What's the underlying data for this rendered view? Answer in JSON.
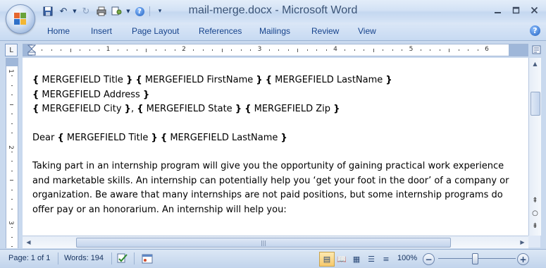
{
  "window": {
    "title": "mail-merge.docx - Microsoft Word",
    "controls": [
      "minimize-icon",
      "maximize-icon",
      "close-icon"
    ]
  },
  "quick_access": [
    "save-icon",
    "undo-icon",
    "redo-icon",
    "print-preview-icon",
    "customize-icon",
    "help-icon"
  ],
  "ribbon": {
    "tabs": [
      "Home",
      "Insert",
      "Page Layout",
      "References",
      "Mailings",
      "Review",
      "View"
    ]
  },
  "ruler": {
    "marks": [
      "1",
      "2",
      "3",
      "4",
      "5",
      "6"
    ],
    "vertical_marks": [
      "1",
      "2",
      "3"
    ]
  },
  "document": {
    "lines": [
      {
        "parts": [
          [
            "{",
            "b"
          ],
          [
            " MERGEFIELD Title ",
            "n"
          ],
          [
            "}",
            "b"
          ],
          [
            " ",
            "n"
          ],
          [
            "{",
            "b"
          ],
          [
            " MERGEFIELD FirstName ",
            "n"
          ],
          [
            "}",
            "b"
          ],
          [
            " ",
            "n"
          ],
          [
            "{",
            "b"
          ],
          [
            " MERGEFIELD LastName ",
            "n"
          ],
          [
            "}",
            "b"
          ]
        ]
      },
      {
        "parts": [
          [
            "{",
            "b"
          ],
          [
            " MERGEFIELD Address  ",
            "n"
          ],
          [
            "}",
            "b"
          ]
        ]
      },
      {
        "parts": [
          [
            "{",
            "b"
          ],
          [
            " MERGEFIELD City ",
            "n"
          ],
          [
            "}",
            "b"
          ],
          [
            ", ",
            "n"
          ],
          [
            "{",
            "b"
          ],
          [
            " MERGEFIELD State  ",
            "n"
          ],
          [
            "}",
            "b"
          ],
          [
            " ",
            "n"
          ],
          [
            "{",
            "b"
          ],
          [
            " MERGEFIELD Zip ",
            "n"
          ],
          [
            "}",
            "b"
          ]
        ]
      },
      {
        "blank": true
      },
      {
        "parts": [
          [
            "Dear ",
            "n"
          ],
          [
            "{",
            "b"
          ],
          [
            " MERGEFIELD Title ",
            "n"
          ],
          [
            "}",
            "b"
          ],
          [
            " ",
            "n"
          ],
          [
            "{",
            "b"
          ],
          [
            " MERGEFIELD LastName  ",
            "n"
          ],
          [
            "}",
            "b"
          ]
        ]
      },
      {
        "blank": true
      },
      {
        "parts": [
          [
            "Taking part in an internship  program will give you the opportunity  of gaining practical work experience",
            "n"
          ]
        ]
      },
      {
        "parts": [
          [
            "and marketable skills.  An internship can potentially help you ‘get your foot in the door’ of a company or",
            "n"
          ]
        ]
      },
      {
        "parts": [
          [
            "organization.  Be aware that many internships are not paid positions,  but some internship programs do",
            "n"
          ]
        ]
      },
      {
        "parts": [
          [
            "offer pay or an honorarium.  An internship will help you:",
            "n"
          ]
        ]
      }
    ]
  },
  "status_bar": {
    "page": "Page: 1 of 1",
    "words": "Words: 194",
    "zoom": "100%",
    "zoom_level_percent": 100
  }
}
